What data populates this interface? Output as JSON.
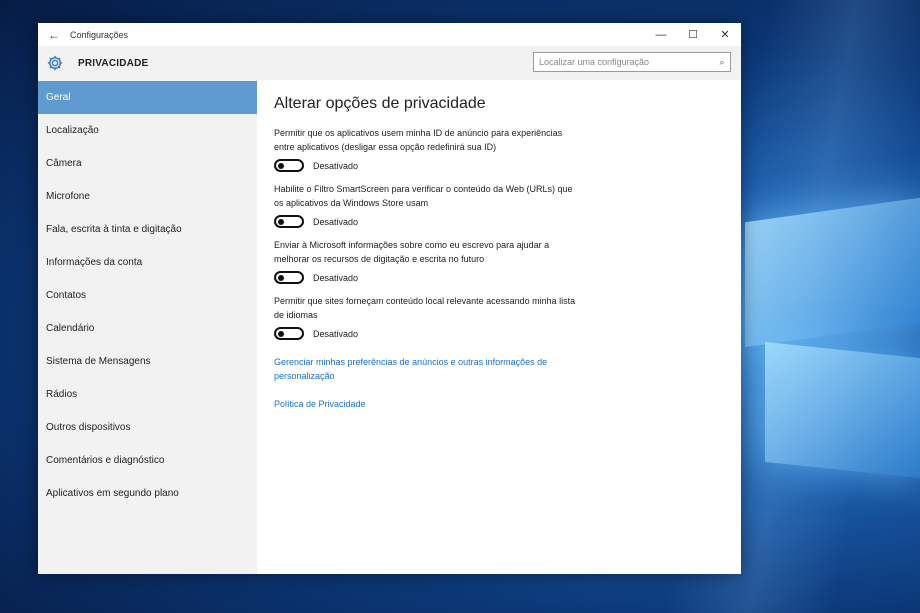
{
  "window": {
    "title": "Configurações",
    "back_glyph": "←",
    "minimize_glyph": "—",
    "maximize_glyph": "☐",
    "close_glyph": "✕"
  },
  "header": {
    "icon": "gear-icon",
    "title": "PRIVACIDADE",
    "search_placeholder": "Localizar uma configuração",
    "search_icon": "search-icon"
  },
  "sidebar": {
    "items": [
      {
        "label": "Geral",
        "active": true
      },
      {
        "label": "Localização"
      },
      {
        "label": "Câmera"
      },
      {
        "label": "Microfone"
      },
      {
        "label": "Fala, escrita à tinta e digitação"
      },
      {
        "label": "Informações da conta"
      },
      {
        "label": "Contatos"
      },
      {
        "label": "Calendário"
      },
      {
        "label": "Sistema de Mensagens"
      },
      {
        "label": "Rádios"
      },
      {
        "label": "Outros dispositivos"
      },
      {
        "label": "Comentários e diagnóstico"
      },
      {
        "label": "Aplicativos em segundo plano"
      }
    ]
  },
  "main": {
    "title": "Alterar opções de privacidade",
    "settings": [
      {
        "description": "Permitir que os aplicativos usem minha ID de anúncio para experiências entre aplicativos (desligar essa opção redefinirá sua ID)",
        "state_label": "Desativado",
        "on": false
      },
      {
        "description": "Habilite o Filtro SmartScreen para verificar o conteúdo da Web (URLs) que os aplicativos da Windows Store usam",
        "state_label": "Desativado",
        "on": false
      },
      {
        "description": "Enviar à Microsoft informações sobre como eu escrevo para ajudar a melhorar os recursos de digitação e escrita no futuro",
        "state_label": "Desativado",
        "on": false
      },
      {
        "description": "Permitir que sites forneçam conteúdo local relevante acessando minha lista de idiomas",
        "state_label": "Desativado",
        "on": false
      }
    ],
    "links": {
      "manage_ads": "Gerenciar minhas preferências de anúncios e outras informações de personalização",
      "privacy_policy": "Política de Privacidade"
    }
  },
  "colors": {
    "accent": "#5f9bd1",
    "link": "#1a6fc7",
    "sidebar_bg": "#f2f2f2"
  }
}
